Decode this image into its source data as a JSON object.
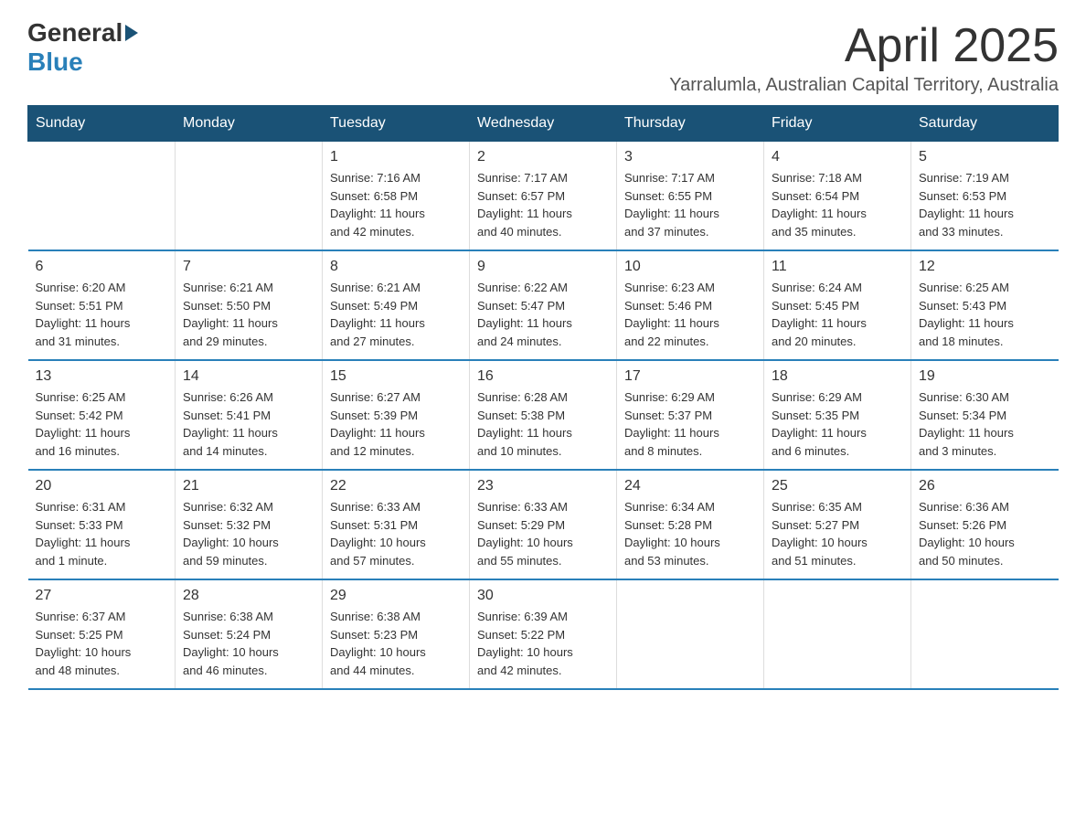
{
  "header": {
    "logo_general": "General",
    "logo_blue": "Blue",
    "month_title": "April 2025",
    "location": "Yarralumla, Australian Capital Territory, Australia"
  },
  "weekdays": [
    "Sunday",
    "Monday",
    "Tuesday",
    "Wednesday",
    "Thursday",
    "Friday",
    "Saturday"
  ],
  "weeks": [
    [
      {
        "day": "",
        "info": ""
      },
      {
        "day": "",
        "info": ""
      },
      {
        "day": "1",
        "info": "Sunrise: 7:16 AM\nSunset: 6:58 PM\nDaylight: 11 hours\nand 42 minutes."
      },
      {
        "day": "2",
        "info": "Sunrise: 7:17 AM\nSunset: 6:57 PM\nDaylight: 11 hours\nand 40 minutes."
      },
      {
        "day": "3",
        "info": "Sunrise: 7:17 AM\nSunset: 6:55 PM\nDaylight: 11 hours\nand 37 minutes."
      },
      {
        "day": "4",
        "info": "Sunrise: 7:18 AM\nSunset: 6:54 PM\nDaylight: 11 hours\nand 35 minutes."
      },
      {
        "day": "5",
        "info": "Sunrise: 7:19 AM\nSunset: 6:53 PM\nDaylight: 11 hours\nand 33 minutes."
      }
    ],
    [
      {
        "day": "6",
        "info": "Sunrise: 6:20 AM\nSunset: 5:51 PM\nDaylight: 11 hours\nand 31 minutes."
      },
      {
        "day": "7",
        "info": "Sunrise: 6:21 AM\nSunset: 5:50 PM\nDaylight: 11 hours\nand 29 minutes."
      },
      {
        "day": "8",
        "info": "Sunrise: 6:21 AM\nSunset: 5:49 PM\nDaylight: 11 hours\nand 27 minutes."
      },
      {
        "day": "9",
        "info": "Sunrise: 6:22 AM\nSunset: 5:47 PM\nDaylight: 11 hours\nand 24 minutes."
      },
      {
        "day": "10",
        "info": "Sunrise: 6:23 AM\nSunset: 5:46 PM\nDaylight: 11 hours\nand 22 minutes."
      },
      {
        "day": "11",
        "info": "Sunrise: 6:24 AM\nSunset: 5:45 PM\nDaylight: 11 hours\nand 20 minutes."
      },
      {
        "day": "12",
        "info": "Sunrise: 6:25 AM\nSunset: 5:43 PM\nDaylight: 11 hours\nand 18 minutes."
      }
    ],
    [
      {
        "day": "13",
        "info": "Sunrise: 6:25 AM\nSunset: 5:42 PM\nDaylight: 11 hours\nand 16 minutes."
      },
      {
        "day": "14",
        "info": "Sunrise: 6:26 AM\nSunset: 5:41 PM\nDaylight: 11 hours\nand 14 minutes."
      },
      {
        "day": "15",
        "info": "Sunrise: 6:27 AM\nSunset: 5:39 PM\nDaylight: 11 hours\nand 12 minutes."
      },
      {
        "day": "16",
        "info": "Sunrise: 6:28 AM\nSunset: 5:38 PM\nDaylight: 11 hours\nand 10 minutes."
      },
      {
        "day": "17",
        "info": "Sunrise: 6:29 AM\nSunset: 5:37 PM\nDaylight: 11 hours\nand 8 minutes."
      },
      {
        "day": "18",
        "info": "Sunrise: 6:29 AM\nSunset: 5:35 PM\nDaylight: 11 hours\nand 6 minutes."
      },
      {
        "day": "19",
        "info": "Sunrise: 6:30 AM\nSunset: 5:34 PM\nDaylight: 11 hours\nand 3 minutes."
      }
    ],
    [
      {
        "day": "20",
        "info": "Sunrise: 6:31 AM\nSunset: 5:33 PM\nDaylight: 11 hours\nand 1 minute."
      },
      {
        "day": "21",
        "info": "Sunrise: 6:32 AM\nSunset: 5:32 PM\nDaylight: 10 hours\nand 59 minutes."
      },
      {
        "day": "22",
        "info": "Sunrise: 6:33 AM\nSunset: 5:31 PM\nDaylight: 10 hours\nand 57 minutes."
      },
      {
        "day": "23",
        "info": "Sunrise: 6:33 AM\nSunset: 5:29 PM\nDaylight: 10 hours\nand 55 minutes."
      },
      {
        "day": "24",
        "info": "Sunrise: 6:34 AM\nSunset: 5:28 PM\nDaylight: 10 hours\nand 53 minutes."
      },
      {
        "day": "25",
        "info": "Sunrise: 6:35 AM\nSunset: 5:27 PM\nDaylight: 10 hours\nand 51 minutes."
      },
      {
        "day": "26",
        "info": "Sunrise: 6:36 AM\nSunset: 5:26 PM\nDaylight: 10 hours\nand 50 minutes."
      }
    ],
    [
      {
        "day": "27",
        "info": "Sunrise: 6:37 AM\nSunset: 5:25 PM\nDaylight: 10 hours\nand 48 minutes."
      },
      {
        "day": "28",
        "info": "Sunrise: 6:38 AM\nSunset: 5:24 PM\nDaylight: 10 hours\nand 46 minutes."
      },
      {
        "day": "29",
        "info": "Sunrise: 6:38 AM\nSunset: 5:23 PM\nDaylight: 10 hours\nand 44 minutes."
      },
      {
        "day": "30",
        "info": "Sunrise: 6:39 AM\nSunset: 5:22 PM\nDaylight: 10 hours\nand 42 minutes."
      },
      {
        "day": "",
        "info": ""
      },
      {
        "day": "",
        "info": ""
      },
      {
        "day": "",
        "info": ""
      }
    ]
  ]
}
